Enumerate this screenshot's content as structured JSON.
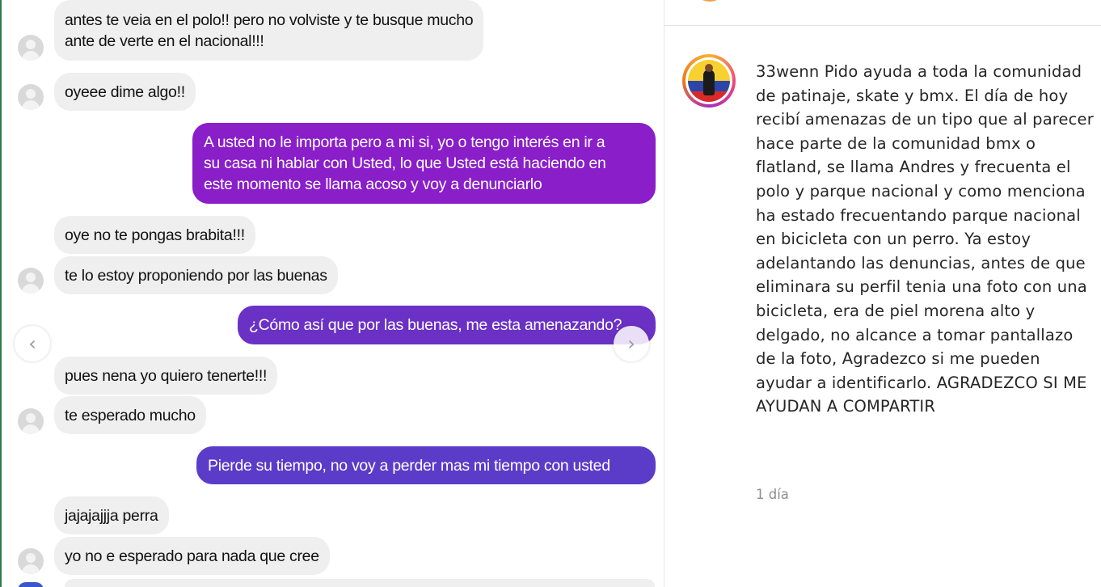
{
  "chat": {
    "messages": [
      {
        "from": "other",
        "text_lines": [
          "antes te veia en el polo!! pero no volviste y te busque mucho",
          "ante de verte en el nacional!!!"
        ]
      },
      {
        "from": "other",
        "text": "oyeee dime algo!!"
      },
      {
        "from": "me",
        "text_lines": [
          "A usted no le importa pero a mi si, yo o tengo interés en ir a",
          "su casa ni hablar con Usted, lo que Usted está haciendo en",
          "este momento se llama acoso y voy a denunciarlo"
        ]
      },
      {
        "from": "other",
        "text": "oye no te pongas brabita!!!"
      },
      {
        "from": "other",
        "text": "te lo estoy proponiendo por las buenas"
      },
      {
        "from": "me",
        "text": "¿Cómo así que por las buenas, me esta amenazando?"
      },
      {
        "from": "other",
        "text": "pues nena yo quiero tenerte!!!"
      },
      {
        "from": "other",
        "text": "te esperado mucho"
      },
      {
        "from": "me",
        "text": "Pierde su tiempo, no voy a perder mas mi tiempo con usted"
      },
      {
        "from": "other",
        "text": "jajajajjja perra"
      },
      {
        "from": "other",
        "text": "yo no e esperado para nada que cree"
      }
    ],
    "nav": {
      "prev_icon": "chevron-left-icon",
      "next_icon": "chevron-right-icon",
      "prev_glyph": "‹",
      "next_glyph": "›"
    }
  },
  "post": {
    "username": "33wenn",
    "caption": "Pido ayuda a toda la comunidad de patinaje, skate y bmx. El día de hoy recibí amenazas de un tipo que al parecer hace parte de la comunidad bmx o flatland, se llama Andres y frecuenta el polo y parque nacional y como menciona ha estado frecuentando parque nacional en bicicleta con un perro. Ya estoy adelantando las denuncias, antes de que eliminara su perfil tenia una foto con una bicicleta, era de piel morena alto y delgado, no alcance a tomar pantallazo de la foto, Agradezco si me pueden ayudar a identificarlo. AGRADEZCO SI ME AYUDAN A COMPARTIR",
    "timestamp": "1 día"
  },
  "colors": {
    "outgoing_1": "#8a1ec9",
    "outgoing_2": "#6b31c5",
    "outgoing_3": "#5a3cc9",
    "incoming": "#efefef"
  }
}
